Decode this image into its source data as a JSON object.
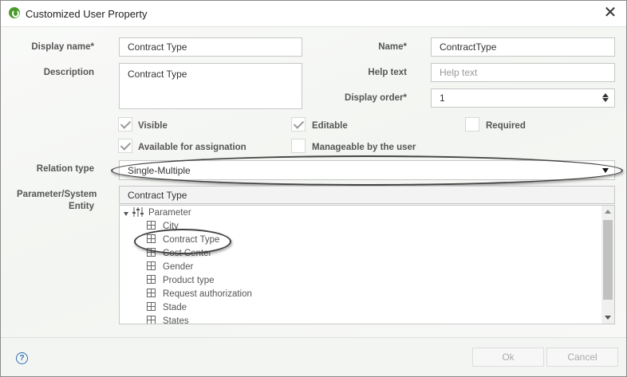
{
  "window": {
    "title": "Customized User Property"
  },
  "form": {
    "display_name_label": "Display name*",
    "display_name_value": "Contract Type",
    "description_label": "Description",
    "description_value": "Contract Type",
    "name_label": "Name*",
    "name_value": "ContractType",
    "help_text_label": "Help text",
    "help_text_placeholder": "Help text",
    "display_order_label": "Display order*",
    "display_order_value": "1",
    "relation_type_label": "Relation type",
    "relation_type_value": "Single-Multiple",
    "param_entity_label_line1": "Parameter/System",
    "param_entity_label_line2": "Entity",
    "param_entity_selected": "Contract Type"
  },
  "checkboxes": {
    "visible": {
      "label": "Visible",
      "checked": true
    },
    "editable": {
      "label": "Editable",
      "checked": true
    },
    "required": {
      "label": "Required",
      "checked": false
    },
    "available": {
      "label": "Available for assignation",
      "checked": true
    },
    "manageable": {
      "label": "Manageable by the user",
      "checked": false
    }
  },
  "tree": {
    "root": "Parameter",
    "items": [
      "City",
      "Contract Type",
      "Cost Center",
      "Gender",
      "Product type",
      "Request authorization",
      "Stade",
      "States"
    ]
  },
  "footer": {
    "ok_label": "Ok",
    "cancel_label": "Cancel",
    "help_icon": "?"
  },
  "colors": {
    "accent": "#4a9a2c",
    "help": "#2f6fb5"
  }
}
